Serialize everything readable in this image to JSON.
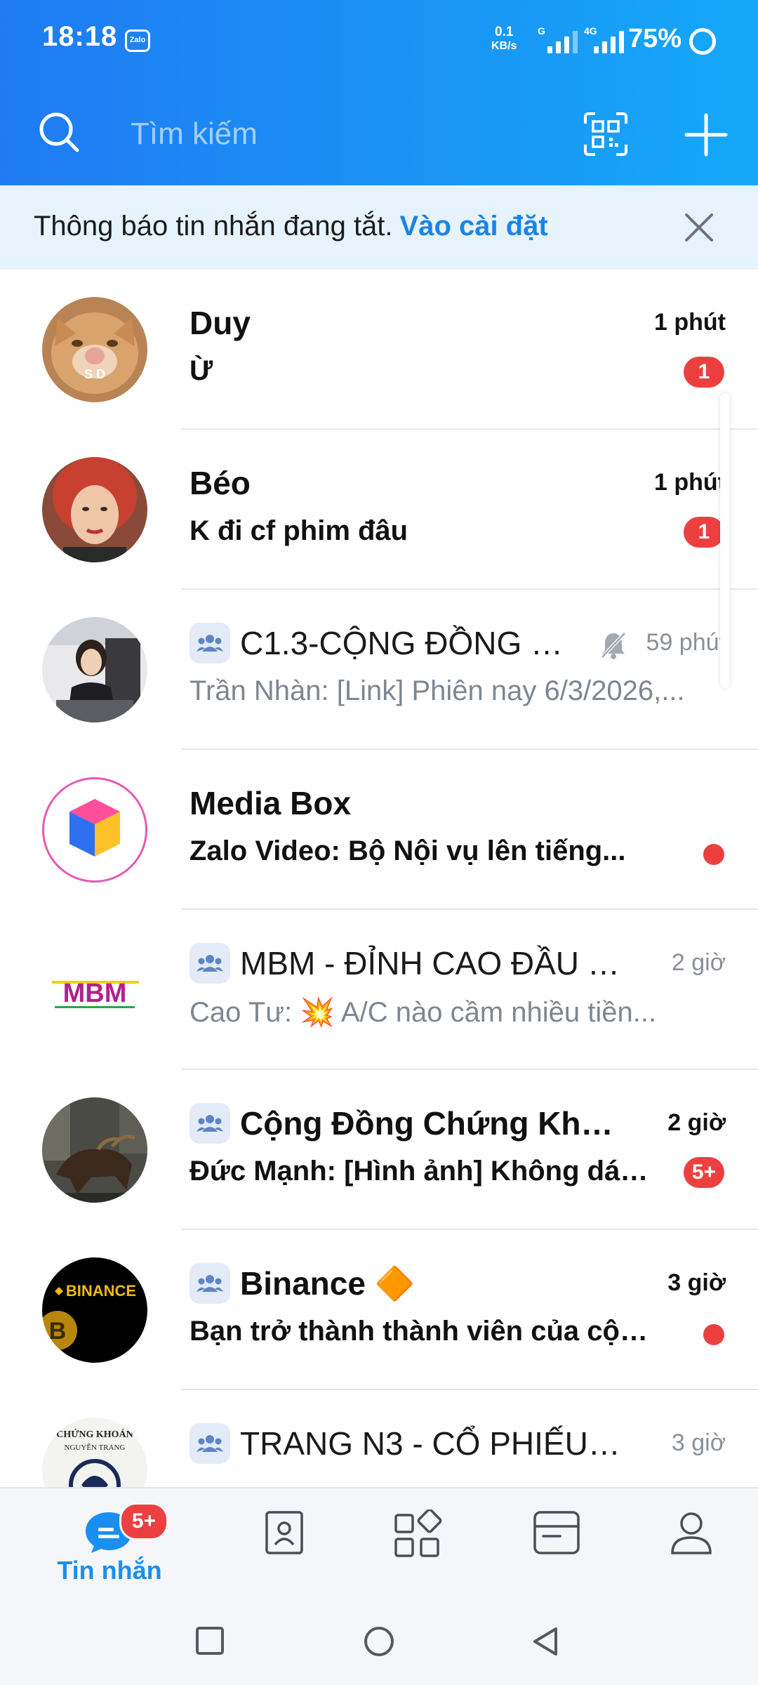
{
  "status_bar": {
    "time": "18:18",
    "app_indicator": "Zalo",
    "net_speed_value": "0.1",
    "net_speed_unit": "KB/s",
    "network_1": "G",
    "network_2": "4G",
    "battery": "75%"
  },
  "search": {
    "placeholder": "Tìm kiếm",
    "qr_icon": "qr-code-icon",
    "add_icon": "plus-icon"
  },
  "notice": {
    "text": "Thông báo tin nhắn đang tắt.",
    "link": "Vào cài đặt"
  },
  "conversations": [
    {
      "name": "Duy",
      "preview": "Ừ",
      "time": "1 phút",
      "unread": "1",
      "is_group": false,
      "bold": true
    },
    {
      "name": "Béo",
      "preview": "K đi cf phim đâu",
      "time": "1 phút",
      "unread": "1",
      "is_group": false,
      "bold": true
    },
    {
      "name": "C1.3-CỘNG ĐỒNG Đ...",
      "preview": "Trần Nhàn: [Link] Phiên nay 6/3/2026,...",
      "time": "59 phút",
      "muted": true,
      "is_group": true,
      "bold": false
    },
    {
      "name": "Media Box",
      "preview": "Zalo Video: Bộ Nội vụ lên tiếng...",
      "time": "",
      "dot": true,
      "is_group": false,
      "bold": true
    },
    {
      "name": "MBM - ĐỈNH CAO ĐẦU T...",
      "preview": "Cao Tư: 💥 A/C nào cầm nhiều tiền...",
      "time": "2 giờ",
      "is_group": true,
      "bold": false
    },
    {
      "name": "Cộng Đồng Chứng Khoán...",
      "preview": "Đức Mạnh: [Hình ảnh] Không dám...",
      "time": "2 giờ",
      "unread": "5+",
      "is_group": true,
      "bold": true
    },
    {
      "name": "Binance 🔶",
      "preview": "Bạn trở thành thành viên của cộng...",
      "time": "3 giờ",
      "dot": true,
      "is_group": true,
      "bold": true
    },
    {
      "name": "TRANG N3 - CỔ PHIẾU D...",
      "preview": "",
      "time": "3 giờ",
      "is_group": true,
      "bold": false
    }
  ],
  "avatars": {
    "duy_text": "S D",
    "mbm_text": "MBM",
    "binance_text": "BINANCE",
    "trang_text_1": "CHỨNG KHOÁN",
    "trang_text_2": "NGUYỄN TRANG"
  },
  "bottom_nav": {
    "messages_label": "Tin nhắn",
    "messages_badge": "5+",
    "items": [
      "chat-icon",
      "contacts-icon",
      "discover-icon",
      "timeline-icon",
      "profile-icon"
    ]
  },
  "colors": {
    "header_start": "#1f7bf2",
    "header_end": "#15a8f8",
    "accent": "#1b84e6",
    "badge": "#ec4040"
  }
}
